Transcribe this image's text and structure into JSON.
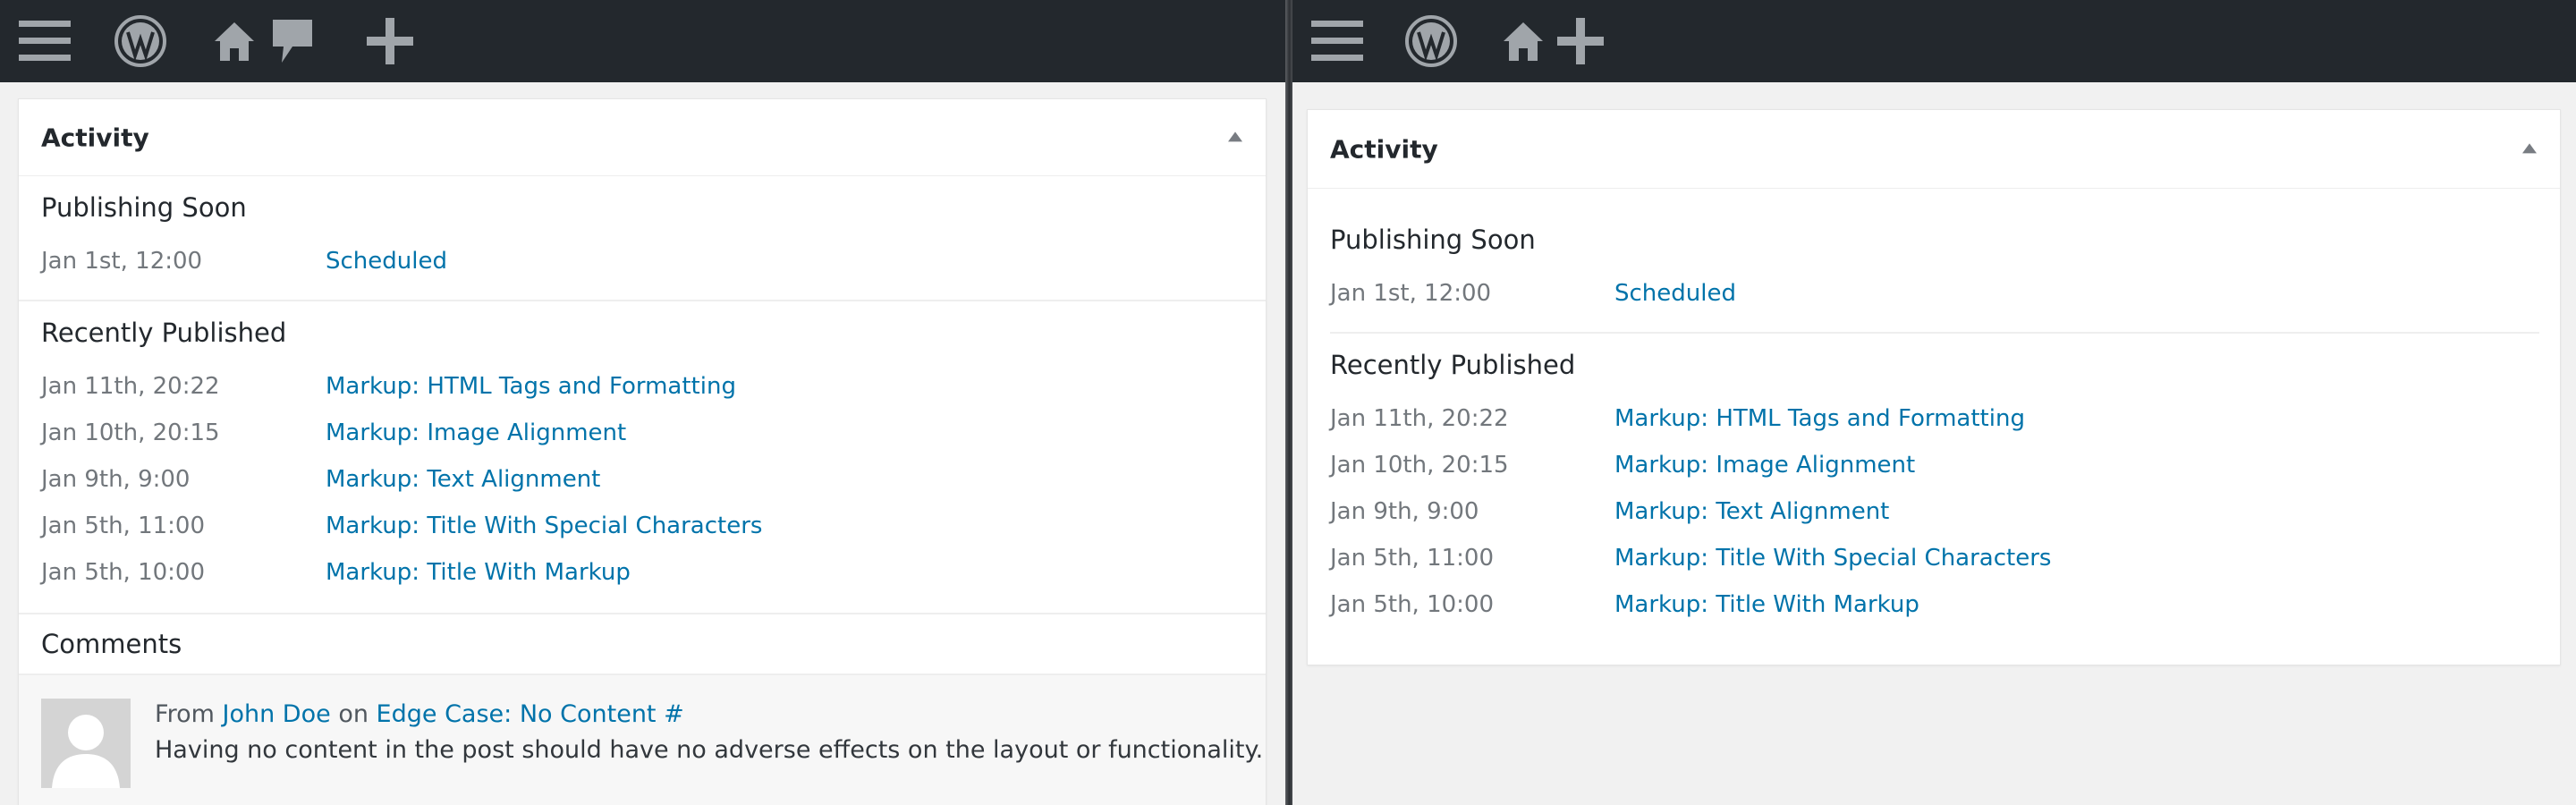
{
  "left": {
    "widget_title": "Activity",
    "publishing_soon": {
      "heading": "Publishing Soon",
      "items": [
        {
          "date": "Jan 1st, 12:00",
          "title": "Scheduled"
        }
      ]
    },
    "recently_published": {
      "heading": "Recently Published",
      "items": [
        {
          "date": "Jan 11th, 20:22",
          "title": "Markup: HTML Tags and Formatting"
        },
        {
          "date": "Jan 10th, 20:15",
          "title": "Markup: Image Alignment"
        },
        {
          "date": "Jan 9th, 9:00",
          "title": "Markup: Text Alignment"
        },
        {
          "date": "Jan 5th, 11:00",
          "title": "Markup: Title With Special Characters"
        },
        {
          "date": "Jan 5th, 10:00",
          "title": "Markup: Title With Markup"
        }
      ]
    },
    "comments": {
      "heading": "Comments",
      "item": {
        "from_label": "From",
        "author": "John Doe",
        "on_label": "on",
        "post_link": "Edge Case: No Content #",
        "text": "Having no content in the post should have no adverse effects on the layout or functionality."
      }
    }
  },
  "right": {
    "widget_title": "Activity",
    "publishing_soon": {
      "heading": "Publishing Soon",
      "items": [
        {
          "date": "Jan 1st, 12:00",
          "title": "Scheduled"
        }
      ]
    },
    "recently_published": {
      "heading": "Recently Published",
      "items": [
        {
          "date": "Jan 11th, 20:22",
          "title": "Markup: HTML Tags and Formatting"
        },
        {
          "date": "Jan 10th, 20:15",
          "title": "Markup: Image Alignment"
        },
        {
          "date": "Jan 9th, 9:00",
          "title": "Markup: Text Alignment"
        },
        {
          "date": "Jan 5th, 11:00",
          "title": "Markup: Title With Special Characters"
        },
        {
          "date": "Jan 5th, 10:00",
          "title": "Markup: Title With Markup"
        }
      ]
    }
  },
  "admin_bar": {
    "icons": [
      "menu-icon",
      "wordpress-logo-icon",
      "home-icon",
      "comments-icon",
      "add-new-icon"
    ]
  },
  "colors": {
    "admin_bar_bg": "#23282d",
    "admin_bar_icon": "#a0a5aa",
    "link": "#0073aa",
    "date_text": "#72777c",
    "page_bg": "#f1f1f1"
  }
}
